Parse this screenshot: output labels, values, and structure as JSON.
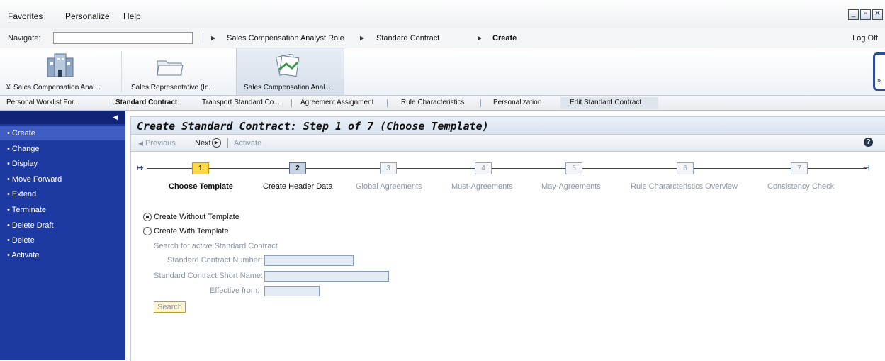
{
  "menu": {
    "favorites": "Favorites",
    "personalize": "Personalize",
    "help": "Help"
  },
  "window_controls": {
    "minimize": "_",
    "restore": "▫",
    "close": "✕"
  },
  "navigate": {
    "label": "Navigate:",
    "breadcrumb": [
      "Sales Compensation Analyst Role",
      "Standard Contract",
      "Create"
    ],
    "logoff": "Log Off"
  },
  "launchpad": {
    "items": [
      {
        "label": "Sales Compensation Anal...",
        "expand": "¥"
      },
      {
        "label": "Sales Representative (In..."
      },
      {
        "label": "Sales Compensation Anal..."
      }
    ]
  },
  "tabs": [
    "Personal Worklist For...",
    "Standard Contract",
    "Transport Standard Co...",
    "Agreement Assignment",
    "Rule Characteristics",
    "Personalization",
    "Edit Standard Contract"
  ],
  "sidebar": {
    "items": [
      "Create",
      "Change",
      "Display",
      "Move Forward",
      "Extend",
      "Terminate",
      "Delete Draft",
      "Delete",
      "Activate"
    ]
  },
  "content": {
    "title": "Create Standard Contract: Step 1 of 7 (Choose Template)",
    "toolbar": {
      "previous": "Previous",
      "next": "Next",
      "activate": "Activate"
    },
    "roadmap": [
      {
        "num": "1",
        "label": "Choose Template"
      },
      {
        "num": "2",
        "label": "Create Header Data"
      },
      {
        "num": "3",
        "label": "Global Agreements"
      },
      {
        "num": "4",
        "label": "Must-Agreements"
      },
      {
        "num": "5",
        "label": "May-Agreements"
      },
      {
        "num": "6",
        "label": "Rule Chararcteristics Overview"
      },
      {
        "num": "7",
        "label": "Consistency Check"
      }
    ],
    "form": {
      "radio_without": "Create Without Template",
      "radio_with": "Create With Template",
      "search_heading": "Search for active Standard Contract",
      "number_label": "Standard Contract Number:",
      "short_name_label": "Standard Contract Short Name:",
      "effective_label": "Effective from:",
      "search_button": "Search"
    }
  }
}
